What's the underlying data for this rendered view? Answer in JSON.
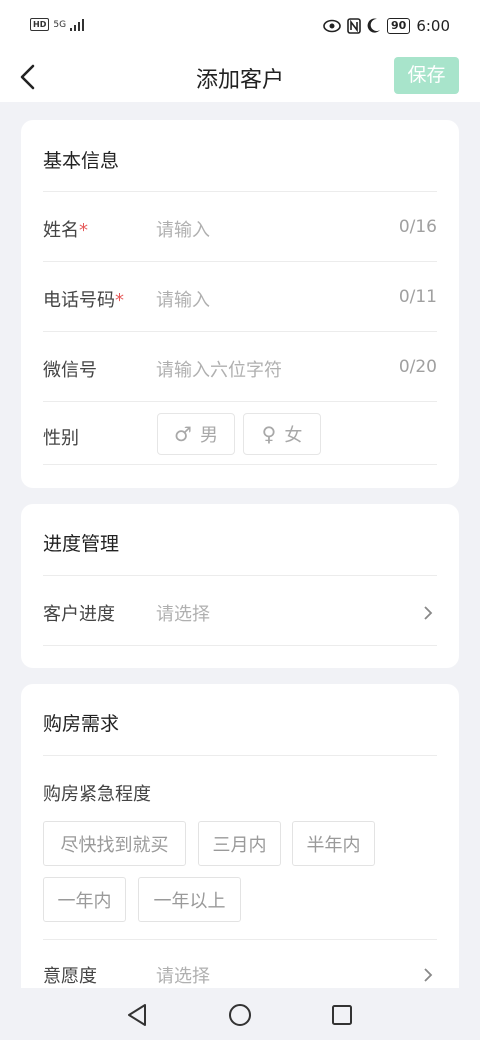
{
  "status_bar": {
    "network_badge": "HD",
    "signal_text": "5G",
    "battery": "90",
    "time": "6:00"
  },
  "header": {
    "title": "添加客户",
    "save_label": "保存",
    "back_icon": "chevron-left-icon"
  },
  "basic_info": {
    "title": "基本信息",
    "name": {
      "label": "姓名",
      "required": "*",
      "placeholder": "请输入",
      "count": "0/16"
    },
    "phone": {
      "label": "电话号码",
      "required": "*",
      "placeholder": "请输入",
      "count": "0/11"
    },
    "wechat": {
      "label": "微信号",
      "placeholder": "请输入六位字符",
      "count": "0/20"
    },
    "gender": {
      "label": "性别",
      "male": "男",
      "female": "女",
      "male_symbol": "♂",
      "female_symbol": "♀"
    }
  },
  "progress": {
    "title": "进度管理",
    "customer_progress": {
      "label": "客户进度",
      "placeholder": "请选择"
    }
  },
  "purchase": {
    "title": "购房需求",
    "urgency_label": "购房紧急程度",
    "urgency_options": [
      "尽快找到就买",
      "三月内",
      "半年内",
      "一年内",
      "一年以上"
    ],
    "intention": {
      "label": "意愿度",
      "placeholder": "请选择"
    }
  },
  "colors": {
    "accent": "#a8e4cb",
    "required": "#e65a5a",
    "background": "#f1f2f6"
  }
}
